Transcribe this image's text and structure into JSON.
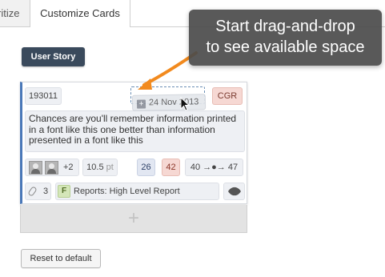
{
  "tabs": {
    "previous_label": "ritize",
    "active_label": "Customize Cards"
  },
  "card_type_label": "User Story",
  "card": {
    "id": "193011",
    "date": "24 Nov 2013",
    "tag": "CGR",
    "description": "Chances are you'll remember information printed in a font like this one better than information presented in a font like this",
    "avatars_extra": "+2",
    "font_size": "10.5",
    "font_unit": "pt",
    "count_a": "26",
    "count_b": "42",
    "flow_text": "40 →●→ 47",
    "attachments": "3",
    "feature_badge": "F",
    "feature_label": "Reports: High Level Report",
    "add_symbol": "+"
  },
  "tooltip": {
    "line1": "Start drag-and-drop",
    "line2": "to see available space"
  },
  "reset_label": "Reset to default",
  "colors": {
    "card_accent": "#4a78b8",
    "badge_dark": "#3a4a5c",
    "arrow": "#f28a1e",
    "tag_red_bg": "#f6d8d3",
    "feature_green_bg": "#d4e6b8"
  },
  "icons": [
    "plus-box-icon",
    "cursor-icon",
    "paperclip-icon",
    "rocket-icon",
    "avatar-icon"
  ]
}
